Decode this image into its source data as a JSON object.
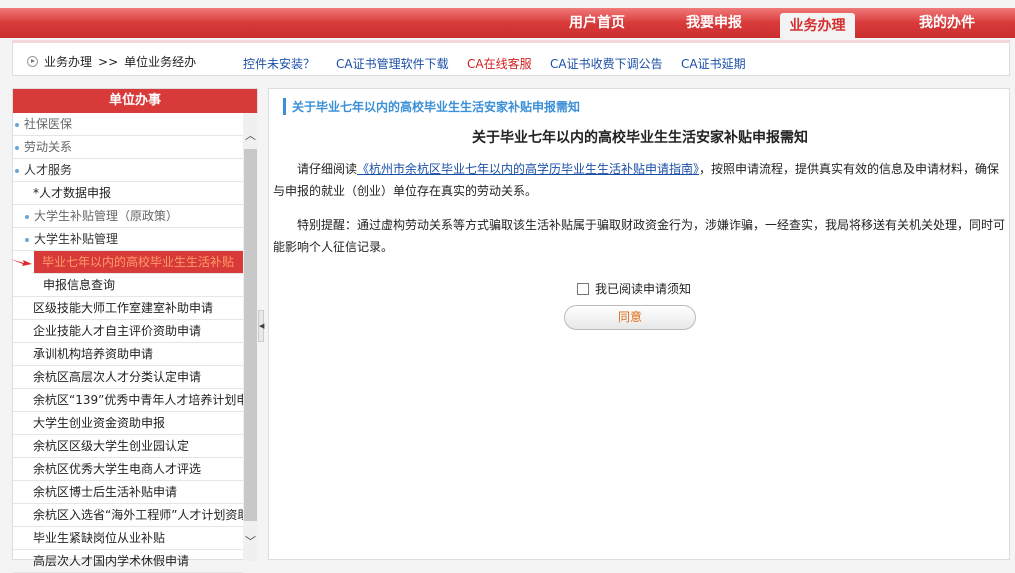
{
  "nav": {
    "tabs": [
      {
        "label": "用户首页"
      },
      {
        "label": "我要申报"
      },
      {
        "label": "业务办理",
        "active": true
      },
      {
        "label": "我的办件"
      }
    ]
  },
  "breadcrumb": {
    "items": [
      "业务办理",
      ">>",
      "单位业务经办"
    ]
  },
  "links": [
    "控件未安装？",
    "CA证书管理软件下载",
    "CA在线客服",
    "CA证书收费下调公告",
    "CA证书延期"
  ],
  "colors": {
    "brand": "#d83a3a",
    "link": "#1a4fa8",
    "accent_blue": "#3b8fd6"
  },
  "sidebar": {
    "title": "单位办事",
    "items": [
      "社保医保",
      "劳动关系",
      "人才服务",
      "*人才数据申报",
      "大学生补贴管理（原政策）",
      "大学生补贴管理",
      "毕业七年以内的高校毕业生生活补贴",
      "申报信息查询",
      "区级技能大师工作室建室补助申请",
      "企业技能人才自主评价资助申请",
      "承训机构培养资助申请",
      "余杭区高层次人才分类认定申请",
      "余杭区“139”优秀中青年人才培养计划申",
      "大学生创业资金资助申报",
      "余杭区区级大学生创业园认定",
      "余杭区优秀大学生电商人才评选",
      "余杭区博士后生活补贴申请",
      "余杭区入选省“海外工程师”人才计划资助",
      "毕业生紧缺岗位从业补贴",
      "高层次人才国内学术休假申请"
    ]
  },
  "main": {
    "section_title": "关于毕业七年以内的高校毕业生生活安家补贴申报需知",
    "heading": "关于毕业七年以内的高校毕业生生活安家补贴申报需知",
    "p1_pre": "请仔细阅读",
    "p1_link": "《杭州市余杭区毕业七年以内的高学历毕业生生活补贴申请指南》",
    "p1_post": "，按照申请流程，提供真实有效的信息及申请材料，确保与申报的就业（创业）单位存在真实的劳动关系。",
    "p2": "特别提醒：通过虚构劳动关系等方式骗取该生活补贴属于骗取财政资金行为，涉嫌诈骗，一经查实，我局将移送有关机关处理，同时可能影响个人征信记录。",
    "checkbox_label": "我已阅读申请须知",
    "agree_button": "同意"
  }
}
